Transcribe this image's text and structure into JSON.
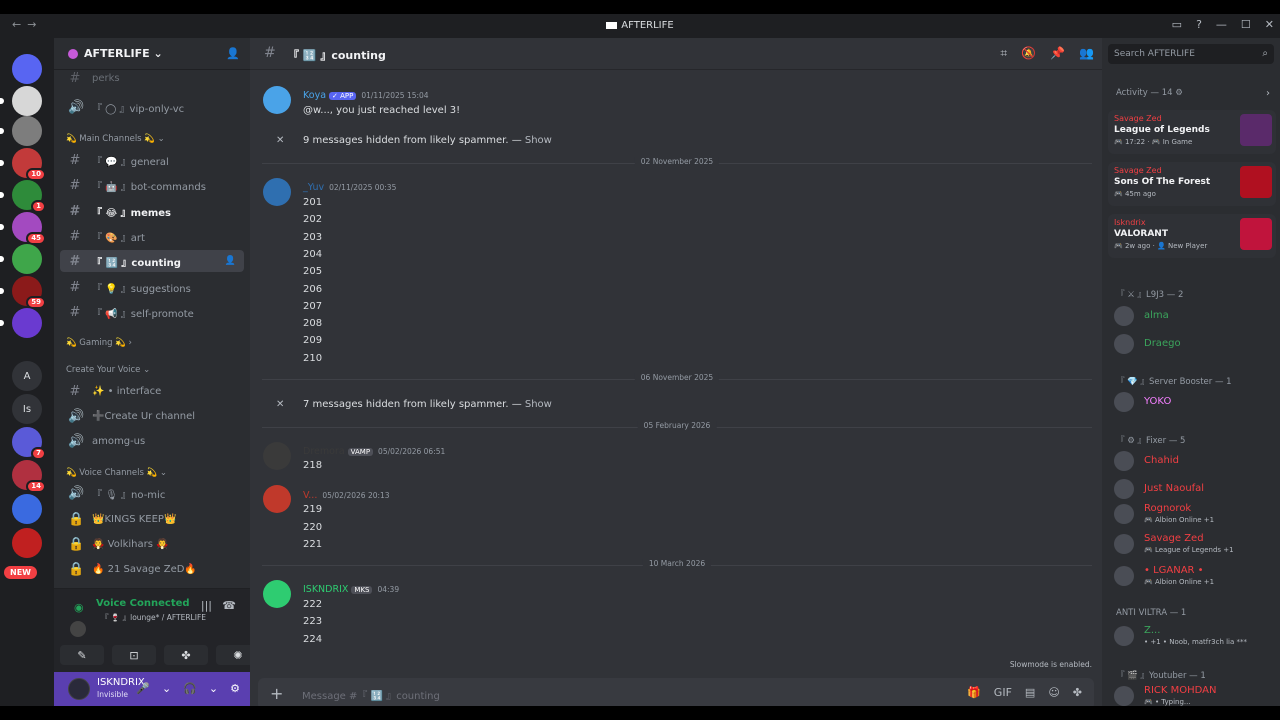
{
  "window": {
    "title": "AFTERLIFE",
    "back": "←",
    "forward": "→",
    "controls": [
      "▭",
      "?",
      "—",
      "☐",
      "✕"
    ]
  },
  "rail": {
    "servers": [
      {
        "name": "home",
        "label": "",
        "color": "#5865f2",
        "badge": ""
      },
      {
        "name": "server-1",
        "label": "",
        "color": "#d7d7d7",
        "badge": ""
      },
      {
        "name": "server-2",
        "label": "",
        "color": "#7d7d7d",
        "badge": ""
      },
      {
        "name": "server-3",
        "label": "",
        "color": "#c23a3a",
        "badge": "10"
      },
      {
        "name": "server-4",
        "label": "",
        "color": "#2e8b3a",
        "badge": "1"
      },
      {
        "name": "server-5",
        "label": "",
        "color": "#a34ac0",
        "badge": "45"
      },
      {
        "name": "server-6",
        "label": "",
        "color": "#3fa64a",
        "badge": ""
      },
      {
        "name": "server-7",
        "label": "",
        "color": "#8b1a1a",
        "badge": "59"
      },
      {
        "name": "server-8",
        "label": "",
        "color": "#6a3ad0",
        "badge": ""
      },
      {
        "name": "server-a",
        "label": "A",
        "color": "#313338",
        "badge": ""
      },
      {
        "name": "server-is",
        "label": "Is",
        "color": "#313338",
        "badge": ""
      },
      {
        "name": "server-9",
        "label": "",
        "color": "#5a5ad8",
        "badge": "7"
      },
      {
        "name": "server-10",
        "label": "",
        "color": "#b03040",
        "badge": "14"
      },
      {
        "name": "server-11",
        "label": "",
        "color": "#3a6ae0",
        "badge": ""
      },
      {
        "name": "server-12",
        "label": "",
        "color": "#c02020",
        "badge": ""
      }
    ],
    "new_label": "NEW"
  },
  "sidebar": {
    "server_name": "AFTERLIFE ⌄",
    "add_member_icon": "👤",
    "top_channel": "perks",
    "channels_a": [
      {
        "label": "『 ◯ 』vip-only-vc",
        "hash": "🔊"
      }
    ],
    "cat_main": "💫 Main Channels 💫 ⌄",
    "channels_main": [
      {
        "label": "『 💬 』general",
        "hash": "#",
        "state": ""
      },
      {
        "label": "『 🤖 』bot-commands",
        "hash": "#",
        "state": ""
      },
      {
        "label": "『 😂 』memes",
        "hash": "#",
        "state": "unread"
      },
      {
        "label": "『 🎨 』art",
        "hash": "#",
        "state": ""
      },
      {
        "label": "『 🔢 』counting",
        "hash": "#",
        "state": "active"
      },
      {
        "label": "『 💡 』suggestions",
        "hash": "#",
        "state": ""
      },
      {
        "label": "『 📢 』self-promote",
        "hash": "#",
        "state": ""
      }
    ],
    "cat_gaming": "💫 Gaming 💫 ›",
    "cat_create": "Create Your Voice ⌄",
    "channels_create": [
      {
        "label": "✨ • interface",
        "hash": "#"
      },
      {
        "label": "➕Create Ur channel",
        "hash": "🔊"
      },
      {
        "label": "amomg-us",
        "hash": "🔊"
      }
    ],
    "cat_voice": "💫 Voice Channels 💫 ⌄",
    "channels_voice": [
      {
        "label": "『 🎙 』no-mic",
        "hash": "🔊"
      },
      {
        "label": "👑KINGS KEEP👑",
        "hash": "🔒"
      },
      {
        "label": "🧛 Volkihars 🧛",
        "hash": "🔒"
      },
      {
        "label": "🔥 21 Savage ZeD🔥",
        "hash": "🔒"
      }
    ],
    "voice": {
      "status": "Voice Connected",
      "location": "『 🍷 』lounge* / AFTERLIFE",
      "buttons": [
        "✎",
        "⊡",
        "✤",
        "✺"
      ]
    },
    "user": {
      "name": "ISKNDRIX",
      "status": "Invisible",
      "controls": [
        "🎤",
        "⌄",
        "🎧",
        "⌄",
        "⚙"
      ]
    }
  },
  "chat": {
    "channel_name": "『 🔢 』counting",
    "header_tools": [
      "⌗",
      "🔕",
      "📌",
      "👥"
    ],
    "hidden_1": {
      "text": "9 messages hidden from likely spammer. —",
      "action": "Show"
    },
    "hidden_2": {
      "text": "7 messages hidden from likely spammer. —",
      "action": "Show"
    },
    "dates": [
      "02 November 2025",
      "06 November 2025",
      "05 February 2026",
      "10 March 2026"
    ],
    "messages": [
      {
        "author": "Koya",
        "tag": "✓ APP",
        "time": "01/11/2025 15:04",
        "color": "#4aa3e8",
        "lines": [
          "@w..., you just reached level 3!"
        ]
      },
      {
        "author": "_Yuv",
        "tag": "",
        "time": "02/11/2025 00:35",
        "color": "#2f6fb0",
        "lines": [
          "201",
          "202",
          "203",
          "204",
          "205",
          "206",
          "207",
          "208",
          "209",
          "210"
        ]
      },
      {
        "author": "Dremora",
        "tag": "VAMP",
        "time": "05/02/2026 06:51",
        "color": "#3a3a3a",
        "lines": [
          "218"
        ]
      },
      {
        "author": "V...",
        "tag": "",
        "time": "05/02/2026 20:13",
        "color": "#c0392b",
        "lines": [
          "219",
          "220",
          "221"
        ]
      },
      {
        "author": "ISKNDRIX",
        "tag": "MKS",
        "time": "04:39",
        "color": "#2ecc71",
        "lines": [
          "222",
          "223",
          "224"
        ]
      }
    ],
    "slowmode": "Slowmode is enabled.",
    "composer_placeholder": "Message #『 🔢 』counting",
    "composer_icons": [
      "🎁",
      "GIF",
      "▤",
      "☺",
      "✤"
    ]
  },
  "members": {
    "search_placeholder": "Search AFTERLIFE",
    "activity_title": "Activity — 14 ⚙",
    "activities": [
      {
        "user": "Savage Zed",
        "game": "League of Legends",
        "meta": "🎮 17:22 · 🎮 In Game",
        "thumb": "#5a2a6a"
      },
      {
        "user": "Savage Zed",
        "game": "Sons Of The Forest",
        "meta": "🎮 45m ago",
        "thumb": "#b01020"
      },
      {
        "user": "Iskndrix",
        "game": "VALORANT",
        "meta": "🎮 2w ago · 👤 New Player",
        "thumb": "#c0143c"
      }
    ],
    "groups": [
      {
        "role": "『 ⚔ 』L9J3 — 2",
        "members": [
          {
            "name": "alma",
            "sub": "",
            "color": "#3ba55c"
          },
          {
            "name": "Draego",
            "sub": "",
            "color": "#3ba55c"
          }
        ]
      },
      {
        "role": "『 💎 』Server Booster — 1",
        "members": [
          {
            "name": "YOKO",
            "sub": "",
            "color": "#f47fff"
          }
        ]
      },
      {
        "role": "『 ⚙ 』Fixer — 5",
        "members": [
          {
            "name": "Chahid",
            "sub": "",
            "color": "#f23f43"
          },
          {
            "name": "Just Naoufal",
            "sub": "",
            "color": "#f23f43"
          },
          {
            "name": "Rognorok",
            "sub": "🎮 Albion Online +1",
            "color": "#f23f43"
          },
          {
            "name": "Savage Zed",
            "sub": "🎮 League of Legends +1",
            "color": "#f23f43"
          },
          {
            "name": "• LGANAR •",
            "sub": "🎮 Albion Online +1",
            "color": "#f23f43"
          }
        ]
      },
      {
        "role": "ANTI VILTRA — 1",
        "members": [
          {
            "name": "Z...",
            "sub": "• +1 • Noob, matfr3ch lia ***",
            "color": "#3ba55c"
          }
        ]
      },
      {
        "role": "『 🎬 』Youtuber — 1",
        "members": [
          {
            "name": "RICK MOHDAN",
            "sub": "🎮 • Typing...",
            "color": "#f23f43"
          }
        ]
      }
    ]
  }
}
